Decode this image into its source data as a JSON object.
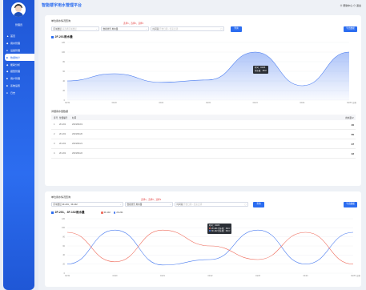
{
  "app": {
    "title": "智能楼宇用水管理平台",
    "top_right": "⊙ 帮助中心   ⊙ 退出"
  },
  "user": {
    "name": "管理员"
  },
  "sidebar": {
    "items": [
      {
        "label": "首页",
        "icon": "▲"
      },
      {
        "label": "用水管理",
        "icon": "◆"
      },
      {
        "label": "设备管理",
        "icon": "●"
      },
      {
        "label": "数据统计",
        "icon": "■"
      },
      {
        "label": "能耗分析",
        "icon": "◆"
      },
      {
        "label": "报警管理",
        "icon": "◆"
      },
      {
        "label": "用户管理",
        "icon": "■"
      },
      {
        "label": "系统设置",
        "icon": "■"
      },
      {
        "label": "日志",
        "icon": "●"
      }
    ],
    "active": 3
  },
  "panel1": {
    "title": "单位用水情况查询",
    "note": "选择1，选择2，选择3",
    "f1_label": "区域楼层",
    "f1_placeholder": "请选择区域楼层",
    "f2_label": "数据类型",
    "f2_value": "用水量",
    "f3_label": "时间段",
    "f3_placeholder": "开始日期",
    "f3_sep": "-",
    "f3_placeholder2": "结束日期",
    "query": "查询",
    "export": "导出数据",
    "chart_title": "2F-201用水量",
    "tooltip_date": "时间：04/23",
    "tooltip_value": "用水量：30m³",
    "table_title": "详细用水量数据",
    "headers": [
      "序号",
      "位置编号",
      "时间",
      "用水量m³"
    ],
    "rows": [
      [
        "1",
        "2F-201",
        "2023/04/19",
        "40"
      ],
      [
        "2",
        "2F-201",
        "2023/04/20",
        "55"
      ],
      [
        "3",
        "2F-201",
        "2023/04/21",
        "37"
      ],
      [
        "4",
        "2F-201",
        "2023/04/22",
        "42"
      ]
    ]
  },
  "panel2": {
    "title": "单位用水情况查询",
    "note": "选择1，选择2，选择3",
    "f1_label": "区域楼层",
    "f1_value": "2F-201、3F-102",
    "f2_label": "数据类型",
    "f2_value": "用水量",
    "f3_label": "时间段",
    "f3_placeholder": "开始日期",
    "f3_sep": "-",
    "f3_placeholder2": "结束日期",
    "query": "查询",
    "export": "导出数据",
    "chart_title": "2F-201、3F-102用水量",
    "tooltip_date": "时间：04/23",
    "tooltip_l1": "2F-201  用水量：30m³",
    "tooltip_l2": "3F-102  用水量：60m³"
  },
  "chart_data": [
    {
      "type": "area",
      "title": "2F-201用水量",
      "x": [
        "04/19",
        "04/20",
        "04/21",
        "04/22",
        "04/23",
        "04/24",
        "04/25"
      ],
      "xticks": [
        "04/19",
        "04/20",
        "04/21",
        "04/22",
        "04/23",
        "04/24",
        "04/25"
      ],
      "x_unit": "日期",
      "ylim": [
        0,
        120
      ],
      "yticks": [
        0,
        20,
        40,
        60,
        80,
        100,
        120
      ],
      "series": [
        {
          "values": [
            40,
            55,
            37,
            42,
            100,
            30,
            100
          ]
        }
      ],
      "color": "#4a7cf0"
    },
    {
      "type": "line",
      "title": "2F-201、3F-102用水量",
      "x": [
        "04/19",
        "04/20",
        "04/21",
        "04/22",
        "04/23",
        "04/24",
        "04/25"
      ],
      "xticks": [
        "04/19",
        "04/20",
        "04/21",
        "04/22",
        "04/23",
        "04/24",
        "04/25"
      ],
      "x_unit": "日期",
      "ylim": [
        0,
        120
      ],
      "yticks": [
        0,
        20,
        40,
        60,
        80,
        100,
        120
      ],
      "series": [
        {
          "name": "2F-201",
          "values": [
            20,
            95,
            18,
            30,
            95,
            20,
            90
          ],
          "color": "#4a7cf0"
        },
        {
          "name": "3F-102",
          "values": [
            90,
            25,
            95,
            60,
            30,
            90,
            20
          ],
          "color": "#ef6b5b"
        }
      ]
    }
  ]
}
